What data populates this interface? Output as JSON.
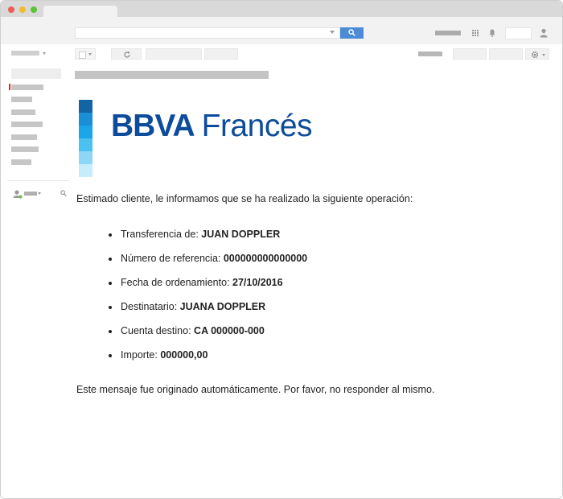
{
  "email": {
    "brand": {
      "part1": "BBVA",
      "part2": "Francés"
    },
    "logo_colors": [
      "#1464a5",
      "#1a8fd6",
      "#1ca5e8",
      "#4cc1f0",
      "#8dd6f6",
      "#c7ecfb"
    ],
    "intro": "Estimado cliente, le informamos que se ha realizado la siguiente operación:",
    "items": [
      {
        "label": "Transferencia de:",
        "value": "JUAN DOPPLER"
      },
      {
        "label": "Número de referencia:",
        "value": "000000000000000"
      },
      {
        "label": "Fecha de ordenamiento:",
        "value": "27/10/2016"
      },
      {
        "label": "Destinatario:",
        "value": "JUANA DOPPLER"
      },
      {
        "label": "Cuenta destino:",
        "value": "CA 000000-000"
      },
      {
        "label": "Importe:",
        "value": "000000,00"
      }
    ],
    "footer": "Este mensaje fue originado automáticamente. Por favor, no responder al mismo."
  },
  "icons": [
    "search-icon",
    "apps-grid-icon",
    "bell-icon",
    "account-icon",
    "refresh-icon",
    "gear-icon",
    "contacts-person-icon"
  ]
}
